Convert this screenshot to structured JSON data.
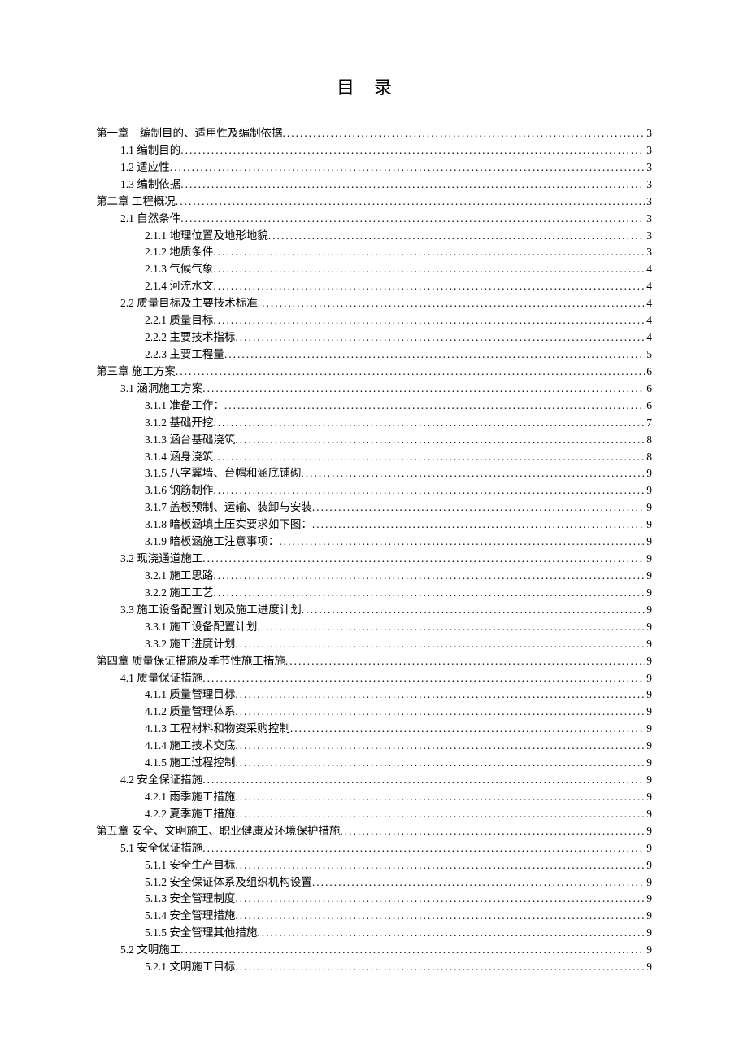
{
  "title": "目录",
  "entries": [
    {
      "level": 0,
      "label": "第一章　编制目的、适用性及编制依据",
      "page": "3"
    },
    {
      "level": 1,
      "label": "1.1 编制目的",
      "page": "3"
    },
    {
      "level": 1,
      "label": "1.2 适应性",
      "page": "3"
    },
    {
      "level": 1,
      "label": "1.3 编制依据",
      "page": "3"
    },
    {
      "level": 0,
      "label": "第二章 工程概况",
      "page": "3"
    },
    {
      "level": 1,
      "label": "2.1 自然条件",
      "page": "3"
    },
    {
      "level": 2,
      "label": "2.1.1 地理位置及地形地貌",
      "page": "3"
    },
    {
      "level": 2,
      "label": "2.1.2 地质条件",
      "page": "3"
    },
    {
      "level": 2,
      "label": "2.1.3 气候气象",
      "page": "4"
    },
    {
      "level": 2,
      "label": "2.1.4 河流水文",
      "page": "4"
    },
    {
      "level": 1,
      "label": "2.2 质量目标及主要技术标准",
      "page": "4"
    },
    {
      "level": 2,
      "label": "2.2.1 质量目标",
      "page": "4"
    },
    {
      "level": 2,
      "label": "2.2.2 主要技术指标",
      "page": "4"
    },
    {
      "level": 2,
      "label": "2.2.3 主要工程量",
      "page": "5"
    },
    {
      "level": 0,
      "label": "第三章 施工方案",
      "page": "6"
    },
    {
      "level": 1,
      "label": "3.1 涵洞施工方案",
      "page": "6"
    },
    {
      "level": 2,
      "label": "3.1.1 准备工作：",
      "page": "6"
    },
    {
      "level": 2,
      "label": "3.1.2 基础开挖",
      "page": "7"
    },
    {
      "level": 2,
      "label": "3.1.3 涵台基础浇筑",
      "page": "8"
    },
    {
      "level": 2,
      "label": "3.1.4 涵身浇筑",
      "page": "8"
    },
    {
      "level": 2,
      "label": "3.1.5 八字翼墙、台帽和涵底铺砌",
      "page": "9"
    },
    {
      "level": 2,
      "label": "3.1.6 钢筋制作",
      "page": "9"
    },
    {
      "level": 2,
      "label": "3.1.7 盖板预制、运输、装卸与安装",
      "page": "9"
    },
    {
      "level": 2,
      "label": "3.1.8 暗板涵填土压实要求如下图：",
      "page": "9"
    },
    {
      "level": 2,
      "label": "3.1.9 暗板涵施工注意事项：",
      "page": "9"
    },
    {
      "level": 1,
      "label": "3.2 现浇通道施工",
      "page": "9"
    },
    {
      "level": 2,
      "label": "3.2.1 施工思路",
      "page": "9"
    },
    {
      "level": 2,
      "label": "3.2.2 施工工艺",
      "page": "9"
    },
    {
      "level": 1,
      "label": "3.3 施工设备配置计划及施工进度计划",
      "page": "9"
    },
    {
      "level": 2,
      "label": "3.3.1 施工设备配置计划",
      "page": "9"
    },
    {
      "level": 2,
      "label": "3.3.2 施工进度计划",
      "page": "9"
    },
    {
      "level": 0,
      "label": "第四章 质量保证措施及季节性施工措施",
      "page": "9"
    },
    {
      "level": 1,
      "label": "4.1 质量保证措施",
      "page": "9"
    },
    {
      "level": 2,
      "label": "4.1.1 质量管理目标",
      "page": "9"
    },
    {
      "level": 2,
      "label": "4.1.2 质量管理体系",
      "page": "9"
    },
    {
      "level": 2,
      "label": "4.1.3 工程材料和物资采购控制",
      "page": "9"
    },
    {
      "level": 2,
      "label": "4.1.4 施工技术交底",
      "page": "9"
    },
    {
      "level": 2,
      "label": "4.1.5 施工过程控制",
      "page": "9"
    },
    {
      "level": 1,
      "label": "4.2 安全保证措施",
      "page": "9"
    },
    {
      "level": 2,
      "label": "4.2.1 雨季施工措施",
      "page": "9"
    },
    {
      "level": 2,
      "label": "4.2.2 夏季施工措施",
      "page": "9"
    },
    {
      "level": 0,
      "label": "第五章 安全、文明施工、职业健康及环境保护措施",
      "page": "9"
    },
    {
      "level": 1,
      "label": "5.1 安全保证措施",
      "page": "9"
    },
    {
      "level": 2,
      "label": "5.1.1 安全生产目标",
      "page": "9"
    },
    {
      "level": 2,
      "label": "5.1.2 安全保证体系及组织机构设置",
      "page": "9"
    },
    {
      "level": 2,
      "label": "5.1.3 安全管理制度",
      "page": "9"
    },
    {
      "level": 2,
      "label": "5.1.4 安全管理措施",
      "page": "9"
    },
    {
      "level": 2,
      "label": "5.1.5 安全管理其他措施",
      "page": "9"
    },
    {
      "level": 1,
      "label": "5.2 文明施工",
      "page": "9"
    },
    {
      "level": 2,
      "label": "5.2.1 文明施工目标",
      "page": "9"
    }
  ]
}
